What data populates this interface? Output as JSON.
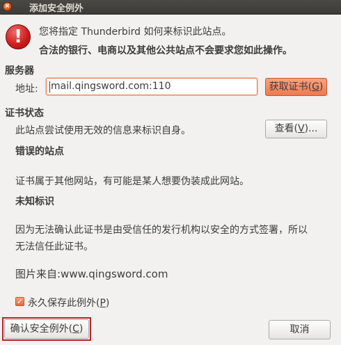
{
  "window": {
    "title": "添加安全例外",
    "close_glyph": "×"
  },
  "header": {
    "icon": "error-icon",
    "question": "您将指定 Thunderbird 如何来标识此站点。",
    "warning": "合法的银行、电商以及其他公共站点不会要求您如此操作。"
  },
  "server": {
    "heading": "服务器",
    "address_label": "地址:",
    "address_value": "mail.qingsword.com:110",
    "get_cert_prefix": "获取证书(",
    "get_cert_key": "G",
    "get_cert_suffix": ")"
  },
  "cert_status": {
    "heading": "证书状态",
    "description": "此站点尝试使用无效的信息来标识自身。",
    "view_prefix": "查看(",
    "view_key": "V",
    "view_suffix": ")...",
    "wrong_site_heading": "错误的站点",
    "wrong_site_text": "证书属于其他网站，有可能是某人想要伪装成此网站。",
    "unknown_heading": "未知标识",
    "unknown_text_line1": "因为无法确认此证书是由受信任的发行机构以安全的方式签署，所以",
    "unknown_text_line2": "无法信任此证书。",
    "source_text": "图片来自:www.qingsword.com"
  },
  "permanent": {
    "checked": true,
    "check_glyph": "✓",
    "label_prefix": "永久保存此例外(",
    "label_key": "P",
    "label_suffix": ")"
  },
  "footer": {
    "confirm_prefix": "确认安全例外(",
    "confirm_key": "C",
    "confirm_suffix": ")",
    "cancel_label": "取消"
  },
  "colors": {
    "accent": "#ef7a4f",
    "focus_ring": "#b3262a",
    "error": "#d01f1f",
    "titlebar": "#3c3b37"
  }
}
